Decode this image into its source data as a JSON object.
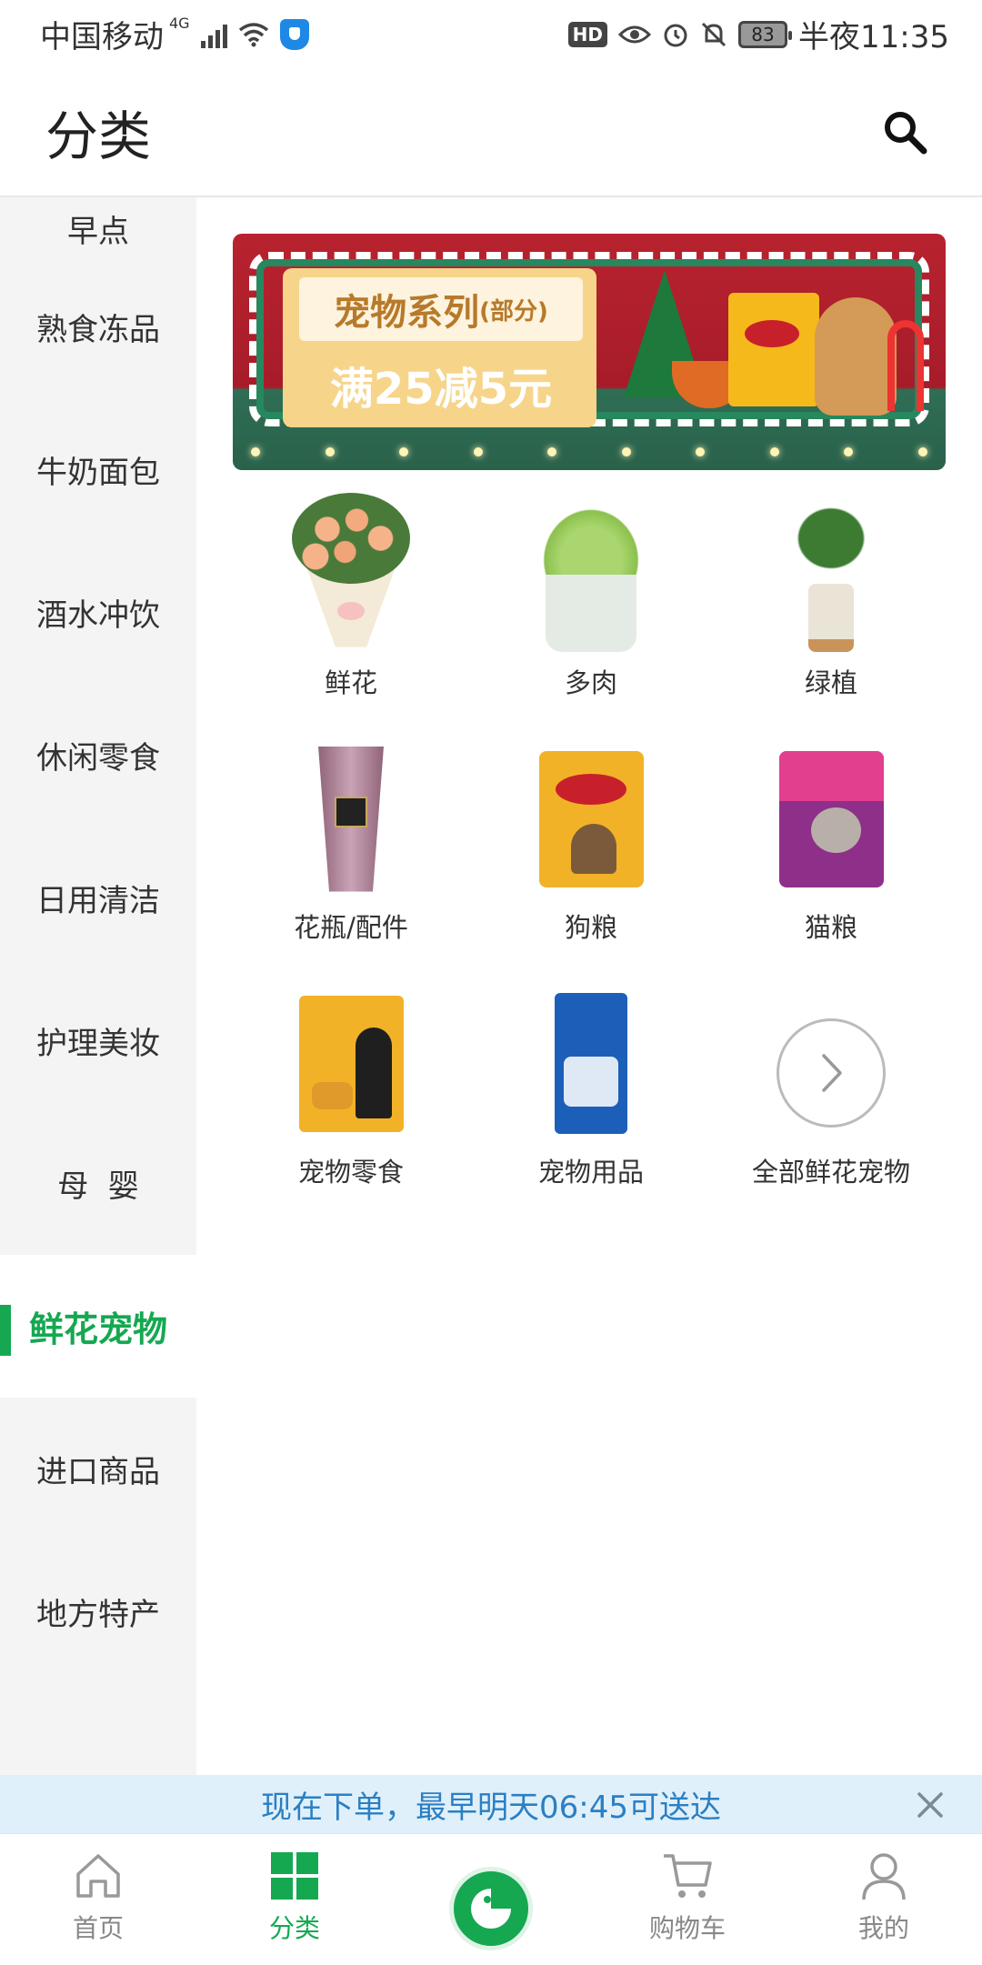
{
  "status_bar": {
    "carrier": "中国移动",
    "network": "4G",
    "battery": "83",
    "time": "半夜11:35",
    "hd": "HD"
  },
  "header": {
    "title": "分类"
  },
  "sidebar": {
    "items": [
      {
        "label": "早点"
      },
      {
        "label": "熟食冻品"
      },
      {
        "label": "牛奶面包"
      },
      {
        "label": "酒水冲饮"
      },
      {
        "label": "休闲零食"
      },
      {
        "label": "日用清洁"
      },
      {
        "label": "护理美妆"
      },
      {
        "label": "母  婴"
      },
      {
        "label": "鲜花宠物"
      },
      {
        "label": "进口商品"
      },
      {
        "label": "地方特产"
      }
    ],
    "active_index": 8
  },
  "banner": {
    "title": "宠物系列",
    "subtitle": "(部分)",
    "offer": "满25减5元"
  },
  "grid": {
    "items": [
      {
        "label": "鲜花",
        "icon": "bouquet"
      },
      {
        "label": "多肉",
        "icon": "succulent"
      },
      {
        "label": "绿植",
        "icon": "fern"
      },
      {
        "label": "花瓶/配件",
        "icon": "vase"
      },
      {
        "label": "狗粮",
        "icon": "dog-food-bag"
      },
      {
        "label": "猫粮",
        "icon": "cat-food-bag"
      },
      {
        "label": "宠物零食",
        "icon": "pet-treat-bag"
      },
      {
        "label": "宠物用品",
        "icon": "cat-litter-bag"
      },
      {
        "label": "全部鲜花宠物",
        "icon": "chevron-right-icon"
      }
    ]
  },
  "notice": {
    "text": "现在下单，最早明天06:45可送达"
  },
  "bottom_nav": {
    "items": [
      {
        "label": "首页",
        "icon": "home-icon"
      },
      {
        "label": "分类",
        "icon": "grid-icon"
      },
      {
        "label": "",
        "icon": "brand-logo-icon"
      },
      {
        "label": "购物车",
        "icon": "cart-icon"
      },
      {
        "label": "我的",
        "icon": "user-icon"
      }
    ],
    "active_index": 1
  },
  "colors": {
    "accent": "#15a851",
    "notice_bg": "#dff0fb",
    "notice_text": "#2b7fc3",
    "sidebar_bg": "#f4f4f4"
  }
}
